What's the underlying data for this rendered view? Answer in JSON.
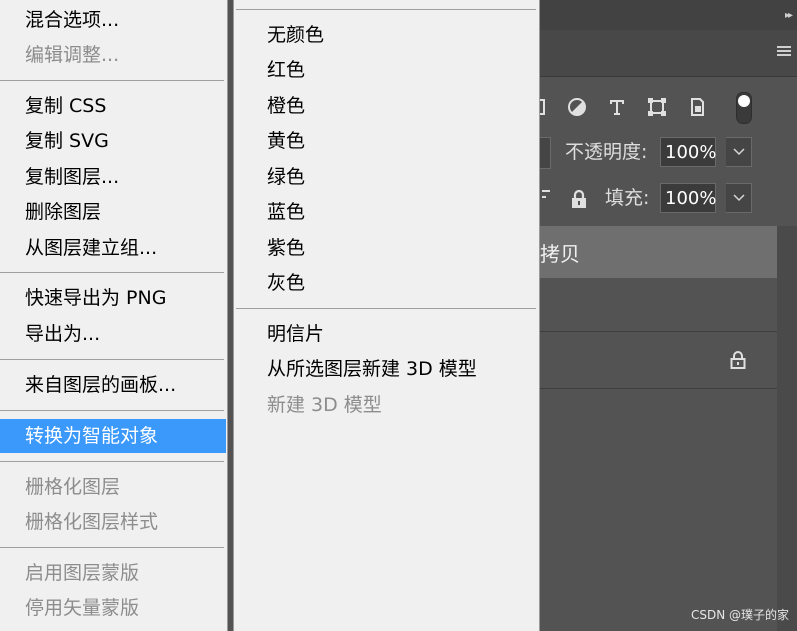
{
  "context_menu": {
    "items": [
      {
        "label": "混合选项...",
        "disabled": false
      },
      {
        "label": "编辑调整...",
        "disabled": true
      },
      {
        "label": "复制 CSS",
        "disabled": false
      },
      {
        "label": "复制 SVG",
        "disabled": false
      },
      {
        "label": "复制图层...",
        "disabled": false
      },
      {
        "label": "删除图层",
        "disabled": false
      },
      {
        "label": "从图层建立组...",
        "disabled": false
      },
      {
        "label": "快速导出为 PNG",
        "disabled": false
      },
      {
        "label": "导出为...",
        "disabled": false
      },
      {
        "label": "来自图层的画板...",
        "disabled": false
      },
      {
        "label": "转换为智能对象",
        "disabled": false,
        "highlighted": true
      },
      {
        "label": "栅格化图层",
        "disabled": true
      },
      {
        "label": "栅格化图层样式",
        "disabled": true
      },
      {
        "label": "启用图层蒙版",
        "disabled": true
      },
      {
        "label": "停用矢量蒙版",
        "disabled": true
      }
    ],
    "highlight_color": "#3b99fc"
  },
  "submenu": {
    "colors": [
      {
        "label": "无颜色"
      },
      {
        "label": "红色"
      },
      {
        "label": "橙色"
      },
      {
        "label": "黄色"
      },
      {
        "label": "绿色"
      },
      {
        "label": "蓝色"
      },
      {
        "label": "紫色"
      },
      {
        "label": "灰色"
      }
    ],
    "postcard": {
      "label": "明信片"
    },
    "new_3d_from_layer": {
      "label": "从所选图层新建 3D 模型"
    },
    "new_3d_model": {
      "label": "新建 3D 模型",
      "disabled": true
    }
  },
  "layers_panel": {
    "opacity_label": "不透明度:",
    "opacity_value": "100%",
    "fill_label": "填充:",
    "fill_value": "100%",
    "selected_layer_name": "拷贝",
    "filter_icons": [
      "adjustment-layer-filter-icon",
      "type-layer-filter-icon",
      "shape-layer-filter-icon",
      "smart-object-filter-icon"
    ],
    "background_color": "#535353"
  },
  "watermark": "CSDN @璞子的家"
}
